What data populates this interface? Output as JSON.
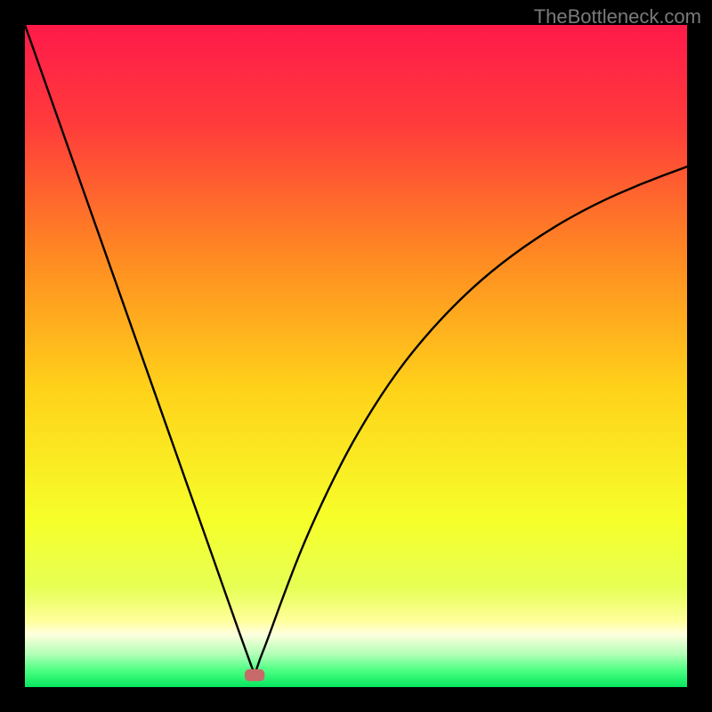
{
  "watermark": "TheBottleneck.com",
  "chart_data": {
    "type": "line",
    "title": "",
    "xlabel": "",
    "ylabel": "",
    "xlim": [
      0,
      100
    ],
    "ylim": [
      0,
      100
    ],
    "grid": false,
    "legend": false,
    "annotations": [],
    "background_gradient": {
      "stops": [
        {
          "offset": 0.0,
          "color": "#ff1a4a"
        },
        {
          "offset": 0.15,
          "color": "#ff3b3b"
        },
        {
          "offset": 0.35,
          "color": "#ff8a22"
        },
        {
          "offset": 0.55,
          "color": "#ffd21a"
        },
        {
          "offset": 0.75,
          "color": "#f6ff2a"
        },
        {
          "offset": 0.85,
          "color": "#e6ff55"
        },
        {
          "offset": 0.9,
          "color": "#ffff9b"
        },
        {
          "offset": 0.92,
          "color": "#ffffdf"
        },
        {
          "offset": 0.95,
          "color": "#b3ffb7"
        },
        {
          "offset": 0.975,
          "color": "#4bff82"
        },
        {
          "offset": 1.0,
          "color": "#07e65f"
        }
      ]
    },
    "series": [
      {
        "name": "bottleneck-curve",
        "color": "#000000",
        "stroke_width": 2.4,
        "x": [
          0,
          3,
          6,
          9,
          12,
          15,
          18,
          21,
          24,
          27,
          30,
          31.5,
          33,
          33.8,
          34.7,
          35.5,
          36.4,
          39,
          42,
          46,
          50,
          55,
          60,
          66,
          72,
          79,
          86,
          93,
          100
        ],
        "y": [
          100,
          91.5,
          83,
          74.5,
          66,
          57.5,
          49,
          40.5,
          32,
          23.5,
          15,
          10.7,
          6.5,
          4.3,
          1.8,
          4.3,
          6.5,
          13.7,
          21.5,
          30.3,
          38,
          46,
          52.5,
          58.9,
          64.1,
          69.0,
          72.9,
          76.0,
          78.6
        ]
      }
    ],
    "marker": {
      "name": "value-marker",
      "x": 34.7,
      "y": 1.8,
      "color": "#c86a6a",
      "width": 3.0,
      "height": 1.8
    }
  }
}
